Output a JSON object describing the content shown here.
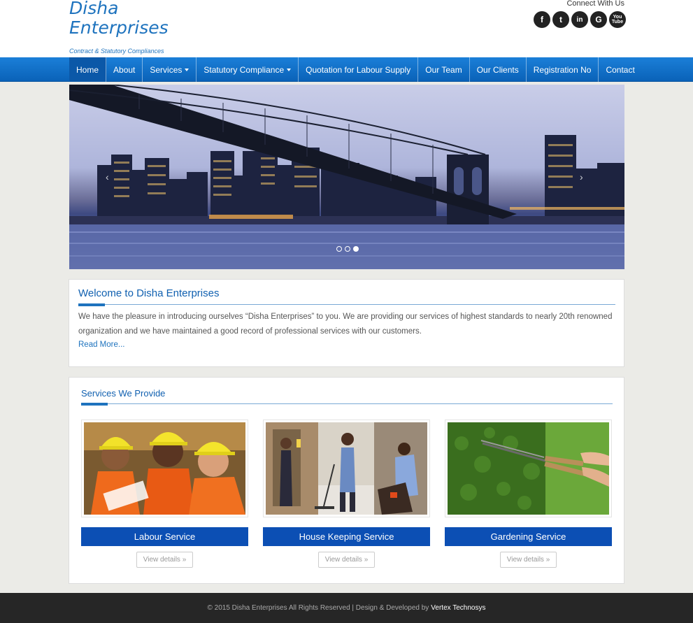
{
  "header": {
    "brand_line1": "Disha",
    "brand_line2": "Enterprises",
    "tagline": "Contract & Statutory Compliances",
    "connect_label": "Connect With Us",
    "socials": [
      {
        "name": "facebook-icon",
        "glyph": "f"
      },
      {
        "name": "twitter-icon",
        "glyph": "t"
      },
      {
        "name": "linkedin-icon",
        "glyph": "in"
      },
      {
        "name": "google-icon",
        "glyph": "G"
      },
      {
        "name": "youtube-icon",
        "glyph": "You Tube"
      }
    ]
  },
  "nav": {
    "items": [
      {
        "label": "Home",
        "active": true
      },
      {
        "label": "About"
      },
      {
        "label": "Services",
        "dropdown": true
      },
      {
        "label": "Statutory Compliance",
        "dropdown": true
      },
      {
        "label": "Quotation for Labour Supply"
      },
      {
        "label": "Our Team"
      },
      {
        "label": "Our Clients"
      },
      {
        "label": "Registration No"
      },
      {
        "label": "Contact"
      }
    ]
  },
  "slider": {
    "slide_count": 3,
    "active_slide": 3
  },
  "welcome": {
    "title": "Welcome to Disha Enterprises",
    "text": "We have the pleasure in introducing ourselves “Disha Enterprises” to you. We are providing our services of highest standards to nearly 20th renowned organization and we have maintained a good record of professional services with our customers.",
    "read_more": "Read More..."
  },
  "services": {
    "title": "Services We Provide",
    "items": [
      {
        "title": "Labour Service",
        "button": "View details »"
      },
      {
        "title": "House Keeping Service",
        "button": "View details »"
      },
      {
        "title": "Gardening Service",
        "button": "View details »"
      }
    ]
  },
  "footer": {
    "text": "© 2015 Disha Enterprises All Rights Reserved | Design & Developed by",
    "developer": "Vertex Technosys"
  },
  "colors": {
    "brand": "#1e73be",
    "nav": "#0a62b8",
    "service_title_bg": "#0c4fb4",
    "footer_bg": "#262626"
  }
}
